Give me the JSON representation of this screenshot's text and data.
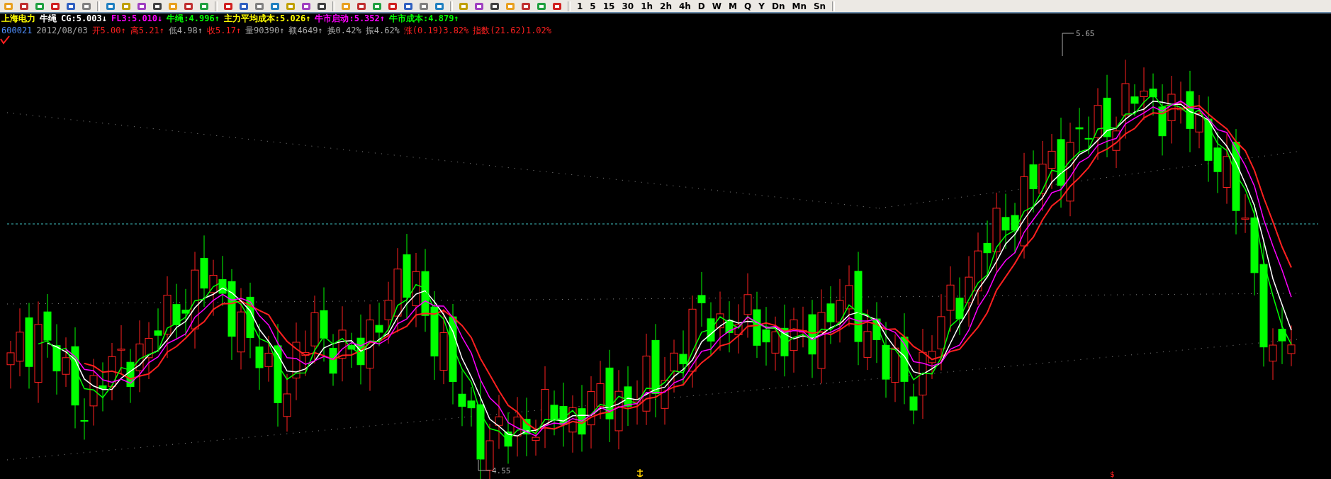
{
  "toolbar": {
    "timeframes": [
      "1",
      "5",
      "15",
      "30",
      "1h",
      "2h",
      "4h",
      "D",
      "W",
      "M",
      "Q",
      "Y",
      "Dn",
      "Mn",
      "Sn"
    ]
  },
  "indicator_line": [
    {
      "text": "上海电力",
      "color": "#ffff00"
    },
    {
      "text": "牛绳",
      "color": "#ffffff"
    },
    {
      "text": "CG:5.003↓",
      "color": "#ffffff"
    },
    {
      "text": "FL3:5.010↓",
      "color": "#ff00ff"
    },
    {
      "text": "牛绳:4.996↑",
      "color": "#00ff00"
    },
    {
      "text": "主力平均成本:5.026↑",
      "color": "#ffff00"
    },
    {
      "text": "牛市启动:5.352↑",
      "color": "#ff00ff"
    },
    {
      "text": "牛市成本:4.879↑",
      "color": "#00ff00"
    }
  ],
  "quote_line": [
    {
      "text": "600021",
      "color": "#4f8fff"
    },
    {
      "text": "2012/08/03",
      "color": "#a8a8a8"
    },
    {
      "text": "开5.00↑",
      "color": "#ff2020"
    },
    {
      "text": "高5.21↑",
      "color": "#ff2020"
    },
    {
      "text": "低4.98↑",
      "color": "#a8a8a8"
    },
    {
      "text": "收5.17↑",
      "color": "#ff2020"
    },
    {
      "text": "量90390↑",
      "color": "#a8a8a8"
    },
    {
      "text": "额4649↑",
      "color": "#a8a8a8"
    },
    {
      "text": "换0.42%",
      "color": "#a8a8a8"
    },
    {
      "text": "振4.62%",
      "color": "#a8a8a8"
    },
    {
      "text": "涨(0.19)3.82%",
      "color": "#ff2020"
    },
    {
      "text": "指数(21.62)1.02%",
      "color": "#ff2020"
    }
  ],
  "chart": {
    "high_label": "5.65",
    "low_label": "4.55",
    "marker": "$"
  }
}
